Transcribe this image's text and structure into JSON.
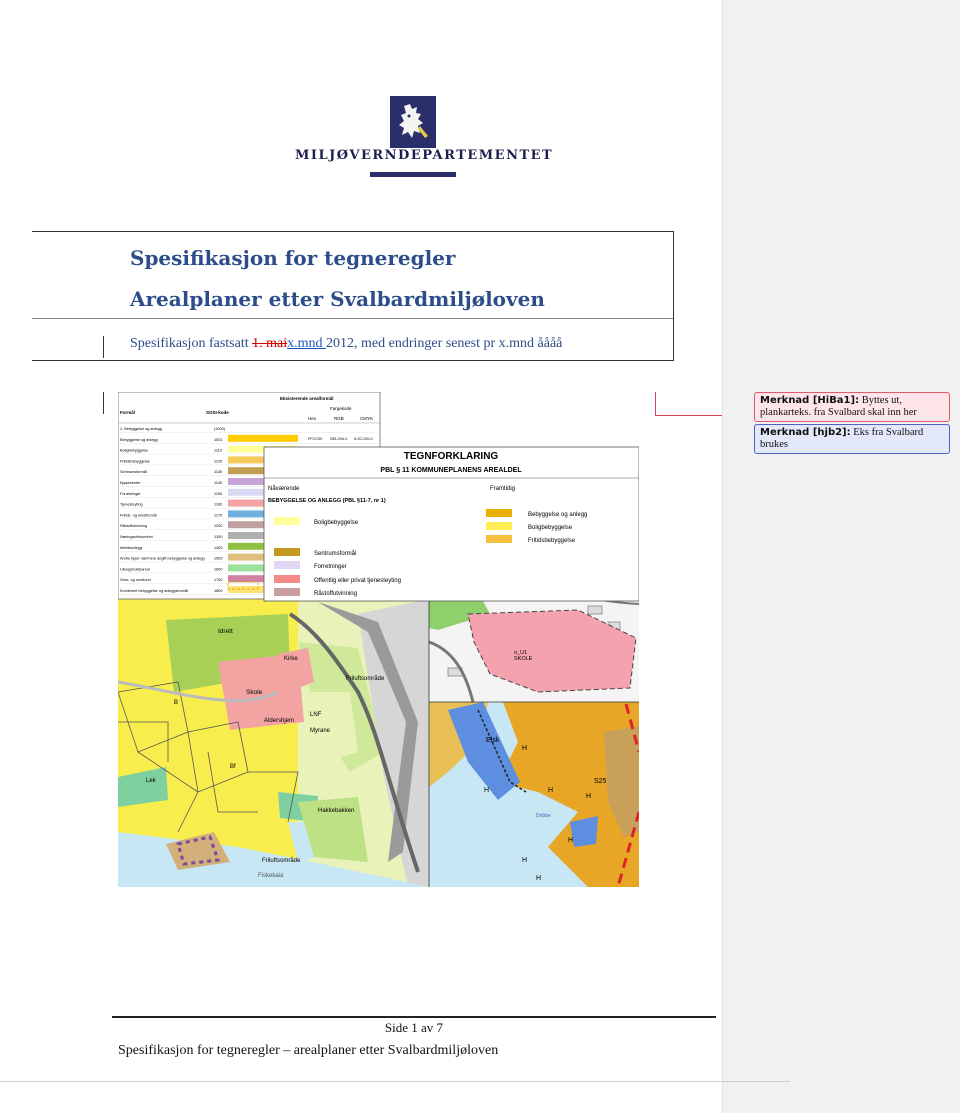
{
  "logo": {
    "organization": "MILJØVERNDEPARTEMENTET",
    "emblem_icon": "norwegian-lion-coat-of-arms",
    "brand_color": "#2a2f6b"
  },
  "document": {
    "title_line1": "Spesifikasjon for tegneregler",
    "title_line2": "Arealplaner etter Svalbardmiljøloven",
    "subtitle": {
      "prefix": "Spesifikasjon fastsatt ",
      "deleted_text": "1. mai",
      "inserted_text": "x.mnd ",
      "suffix": " 2012,  med endringer senest pr  x.mnd åååå"
    },
    "title_color": "#2c4d8a"
  },
  "figure": {
    "legend_table": {
      "header": "Eksisterende arealformål",
      "col_formal": "Formål",
      "col_sosi": "SOSI-kode",
      "col_fargekode": "Fargekode",
      "col_hex": "Hex",
      "col_rgb": "RGB",
      "col_cmyk": "CMYK",
      "rows": [
        {
          "label": "1. Bebyggelse og anlegg",
          "code": "(1000)"
        },
        {
          "label": "Bebyggelse og anlegg",
          "code": "1001"
        },
        {
          "label": "Boligbebyggelse",
          "code": "1110"
        },
        {
          "label": "Fritidsbebyggelse",
          "code": "1120"
        },
        {
          "label": "Sentrumsformål",
          "code": "1130"
        },
        {
          "label": "Kjøpesenter",
          "code": "1140"
        },
        {
          "label": "Forretninger",
          "code": "1150"
        },
        {
          "label": "Tjenesteyting",
          "code": "1160"
        },
        {
          "label": "Fritids- og turistformål",
          "code": "1170"
        },
        {
          "label": "Råstoffutvinning",
          "code": "1200"
        },
        {
          "label": "Næringsvirksomhet",
          "code": "1300"
        },
        {
          "label": "Idrettsanlegg",
          "code": "1400"
        },
        {
          "label": "Andre typer nærmere angitt bebyggelse og anlegg",
          "code": "1500"
        },
        {
          "label": "Uteoppholdsareal",
          "code": "1600"
        },
        {
          "label": "Grav- og urnelund",
          "code": "1700"
        },
        {
          "label": "Kombinert bebyggelse og anleggsformål",
          "code": "1800"
        }
      ],
      "first_value": {
        "hex": "FFCC00",
        "rgb": "255-204-0",
        "cmyk": "0-20-100-0"
      }
    },
    "tegnforklaring": {
      "title": "TEGNFORKLARING",
      "subtitle": "PBL § 11 KOMMUNEPLANENS AREALDEL",
      "col_left": "Nåværende",
      "col_right": "Framtidig",
      "section": "BEBYGGELSE OG ANLEGG (PBL §11-7, nr 1)",
      "left_items": [
        "Boligbebyggelse",
        "Sentrumsformål",
        "Forretninger",
        "Offentlig eller privat tjenesteyting",
        "Råstoffutvinning"
      ],
      "right_items": [
        "Bebyggelse og anlegg",
        "Boligbebyggelse",
        "Fritidsbebyggelse"
      ]
    },
    "map_labels": [
      "Idrett",
      "Skole",
      "Kirke",
      "LNF",
      "Friluftsområde",
      "Aldershjem",
      "Myrane",
      "Bf",
      "Lek",
      "B",
      "Friluftsområde",
      "Hakkebakken",
      "Fiskekaia"
    ],
    "map2_labels": [
      "FR",
      "o_U1",
      "SKOLE"
    ],
    "map3_labels": [
      "Elsk",
      "H",
      "S25",
      "Dobbe"
    ]
  },
  "comments": [
    {
      "author": "Merknad [HiBa1]:",
      "text": " Byttes ut, plankarteks. fra Svalbard skal inn her"
    },
    {
      "author": "Merknad [hjb2]:",
      "text": " Eks fra Svalbard brukes"
    }
  ],
  "footer": {
    "page": "Side 1 av 7",
    "title": "Spesifikasjon for tegneregler – arealplaner etter Svalbardmiljøloven"
  }
}
